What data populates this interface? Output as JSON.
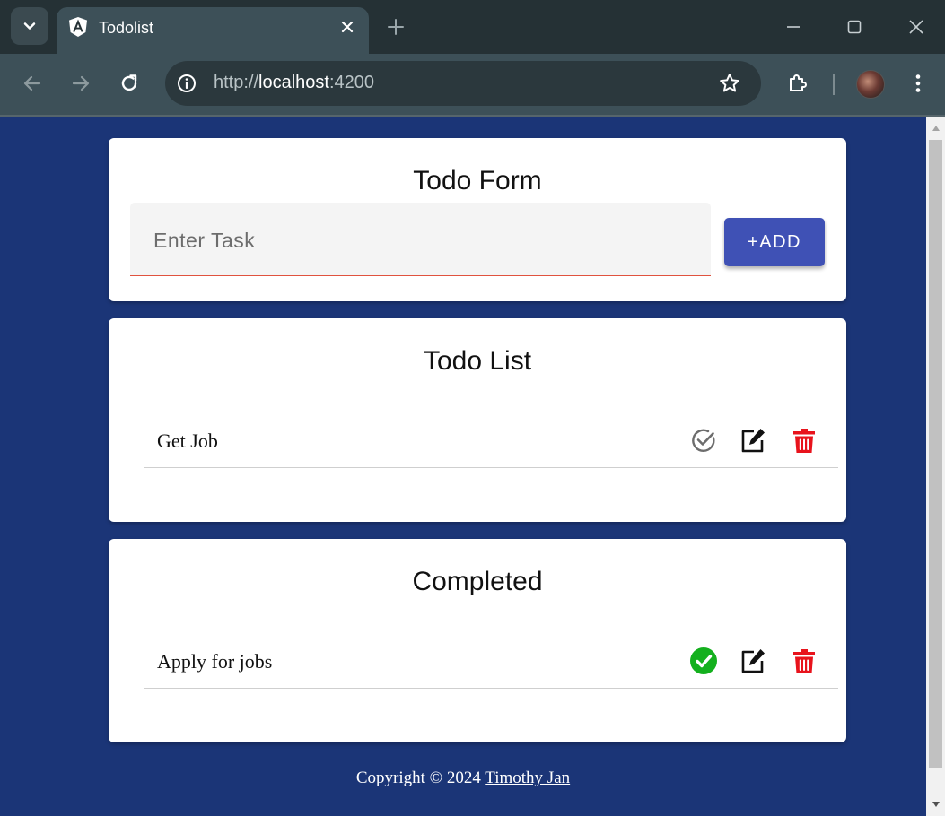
{
  "browser": {
    "tab_title": "Todolist",
    "url_scheme": "http://",
    "url_host": "localhost",
    "url_port": ":4200"
  },
  "form": {
    "title": "Todo Form",
    "task_placeholder": "Enter Task",
    "task_value": "",
    "add_label": "+ADD"
  },
  "todo_list": {
    "title": "Todo List",
    "items": [
      {
        "text": "Get Job",
        "completed": false
      }
    ]
  },
  "completed": {
    "title": "Completed",
    "items": [
      {
        "text": "Apply for jobs",
        "completed": true
      }
    ]
  },
  "footer": {
    "copyright": "Copyright © 2024",
    "author": "Timothy Jan"
  },
  "colors": {
    "page_bg": "#1b3577",
    "accent": "#3f51b5",
    "delete": "#e8131c",
    "complete": "#14b01e"
  },
  "icons": [
    "tab-list-icon",
    "angular-icon",
    "close-icon",
    "plus-icon",
    "minimize-icon",
    "maximize-icon",
    "back-icon",
    "forward-icon",
    "reload-icon",
    "info-icon",
    "star-icon",
    "extensions-icon",
    "more-icon",
    "check-circle-icon",
    "edit-icon",
    "trash-icon"
  ]
}
